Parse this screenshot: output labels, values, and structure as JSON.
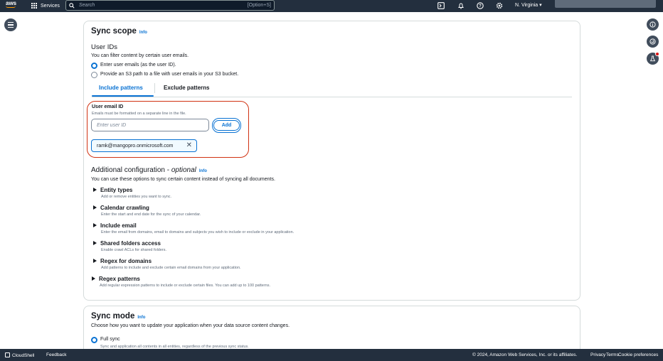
{
  "topnav": {
    "logo": "aws",
    "services_label": "Services",
    "search_placeholder": "Search",
    "search_shortcut": "[Option+S]",
    "region": "N. Virginia"
  },
  "sync_scope": {
    "title": "Sync scope",
    "info": "Info",
    "user_ids_heading": "User IDs",
    "user_ids_desc": "You can filter content by certain user emails.",
    "radio_options": [
      {
        "label": "Enter user emails (as the user ID).",
        "selected": true
      },
      {
        "label": "Provide an S3 path to a file with user emails in your S3 bucket.",
        "selected": false
      }
    ],
    "tabs": [
      {
        "label": "Include patterns",
        "active": true
      },
      {
        "label": "Exclude patterns",
        "active": false
      }
    ],
    "email_field_label": "User email ID",
    "email_field_hint": "Emails must be formatted on a separate line in the file.",
    "email_placeholder": "Enter user ID",
    "add_label": "Add",
    "tokens": [
      "ramk@mangopro.onmicrosoft.com"
    ]
  },
  "additional_config": {
    "title_prefix": "Additional configuration - ",
    "title_optional": "optional",
    "info": "Info",
    "description": "You can use these options to sync certain content instead of syncing all documents.",
    "sections": [
      {
        "title": "Entity types",
        "desc": "Add or remove entities you want to sync."
      },
      {
        "title": "Calendar crawling",
        "desc": "Enter the start and end date for the sync of your calendar."
      },
      {
        "title": "Include email",
        "desc": "Enter the email from domains, email to domains and subjects you wish to include or exclude in your application."
      },
      {
        "title": "Shared folders access",
        "desc": "Enable crawl ACLs for shared folders."
      },
      {
        "title": "Regex for domains",
        "desc": "Add patterns to include and exclude certain email domains from your application."
      },
      {
        "title": "Regex patterns",
        "desc": "Add regular expression patterns to include or exclude certain files. You can add up to 100 patterns."
      }
    ]
  },
  "sync_mode": {
    "title": "Sync mode",
    "info": "Info",
    "description": "Choose how you want to update your application when your data source content changes.",
    "option_label": "Full sync",
    "option_desc": "Sync and application all contents in all entities, regardless of the previous sync status."
  },
  "footer": {
    "cloudshell": "CloudShell",
    "feedback": "Feedback",
    "copyright": "© 2024, Amazon Web Services, Inc. or its affiliates.",
    "privacy": "Privacy",
    "terms": "Terms",
    "cookie": "Cookie preferences"
  }
}
